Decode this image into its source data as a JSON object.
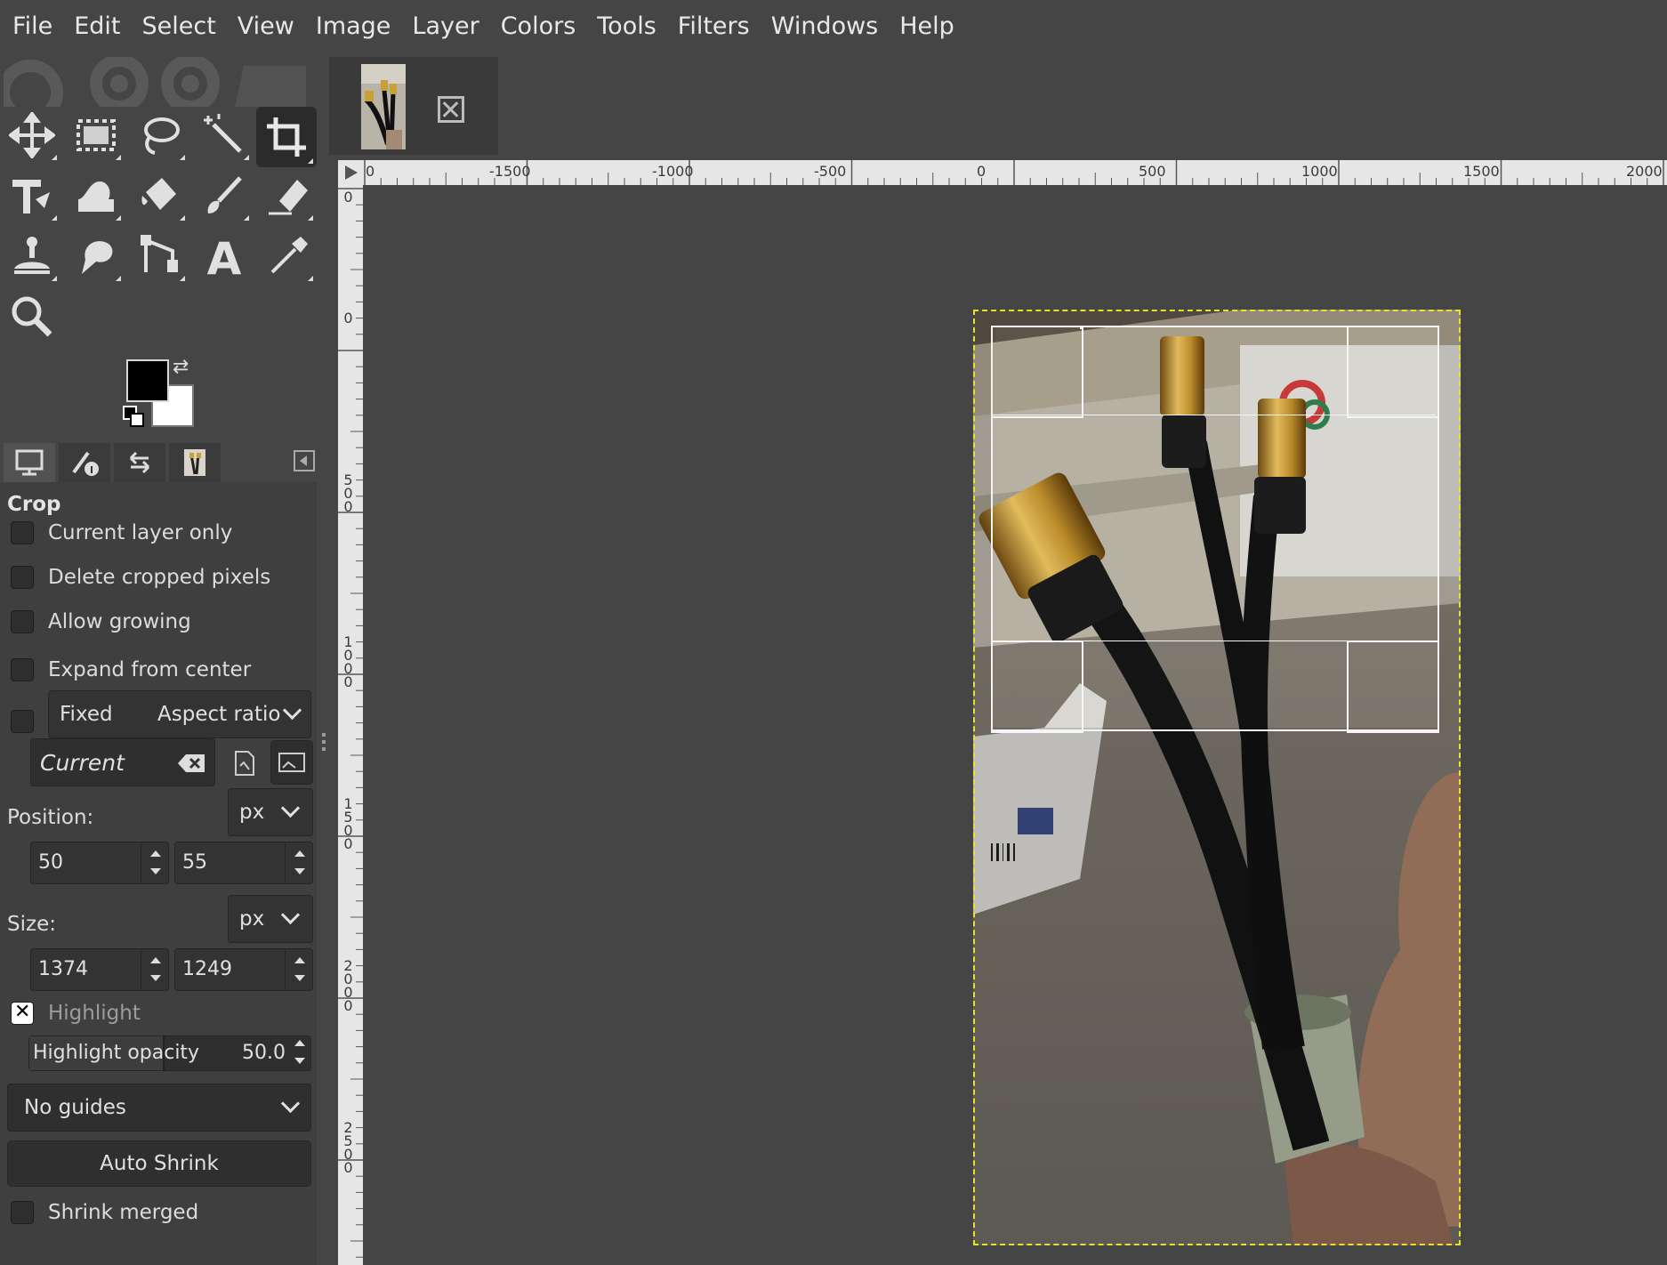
{
  "menubar": {
    "items": [
      "File",
      "Edit",
      "Select",
      "View",
      "Image",
      "Layer",
      "Colors",
      "Tools",
      "Filters",
      "Windows",
      "Help"
    ]
  },
  "toolbox": {
    "tools": [
      "move-tool",
      "rect-select-tool",
      "free-select-tool",
      "fuzzy-select-tool",
      "crop-tool",
      "transform-tool",
      "warp-tool",
      "bucket-fill-tool",
      "paintbrush-tool",
      "eraser-tool",
      "clone-tool",
      "smudge-tool",
      "paths-tool",
      "text-tool",
      "color-picker-tool",
      "zoom-tool"
    ],
    "active": "crop-tool",
    "text_tool_glyph": "A"
  },
  "colors": {
    "foreground": "#000000",
    "background": "#ffffff"
  },
  "dock_tabs": [
    "tool-options",
    "device-status",
    "undo-history",
    "images"
  ],
  "crop_options": {
    "title": "Crop",
    "current_layer_only": "Current layer only",
    "delete_cropped": "Delete cropped pixels",
    "allow_growing": "Allow growing",
    "expand_from_center": "Expand from center",
    "fixed": "Fixed",
    "aspect_mode": "Aspect ratio",
    "current": "Current",
    "position_label": "Position:",
    "position_unit": "px",
    "position_x": "50",
    "position_y": "55",
    "size_label": "Size:",
    "size_unit": "px",
    "size_w": "1374",
    "size_h": "1249",
    "highlight": "Highlight",
    "highlight_opacity_label": "Highlight opacity",
    "highlight_opacity": "50.0",
    "guides": "No guides",
    "auto_shrink": "Auto Shrink",
    "shrink_merged": "Shrink merged"
  },
  "hruler": {
    "labels": [
      "0",
      "-1500",
      "-1000",
      "-500",
      "0",
      "500",
      "1000",
      "1500",
      "2000"
    ]
  },
  "vruler": {
    "labels": [
      "0",
      "0",
      "500",
      "1000",
      "1500",
      "2000",
      "2500"
    ]
  }
}
